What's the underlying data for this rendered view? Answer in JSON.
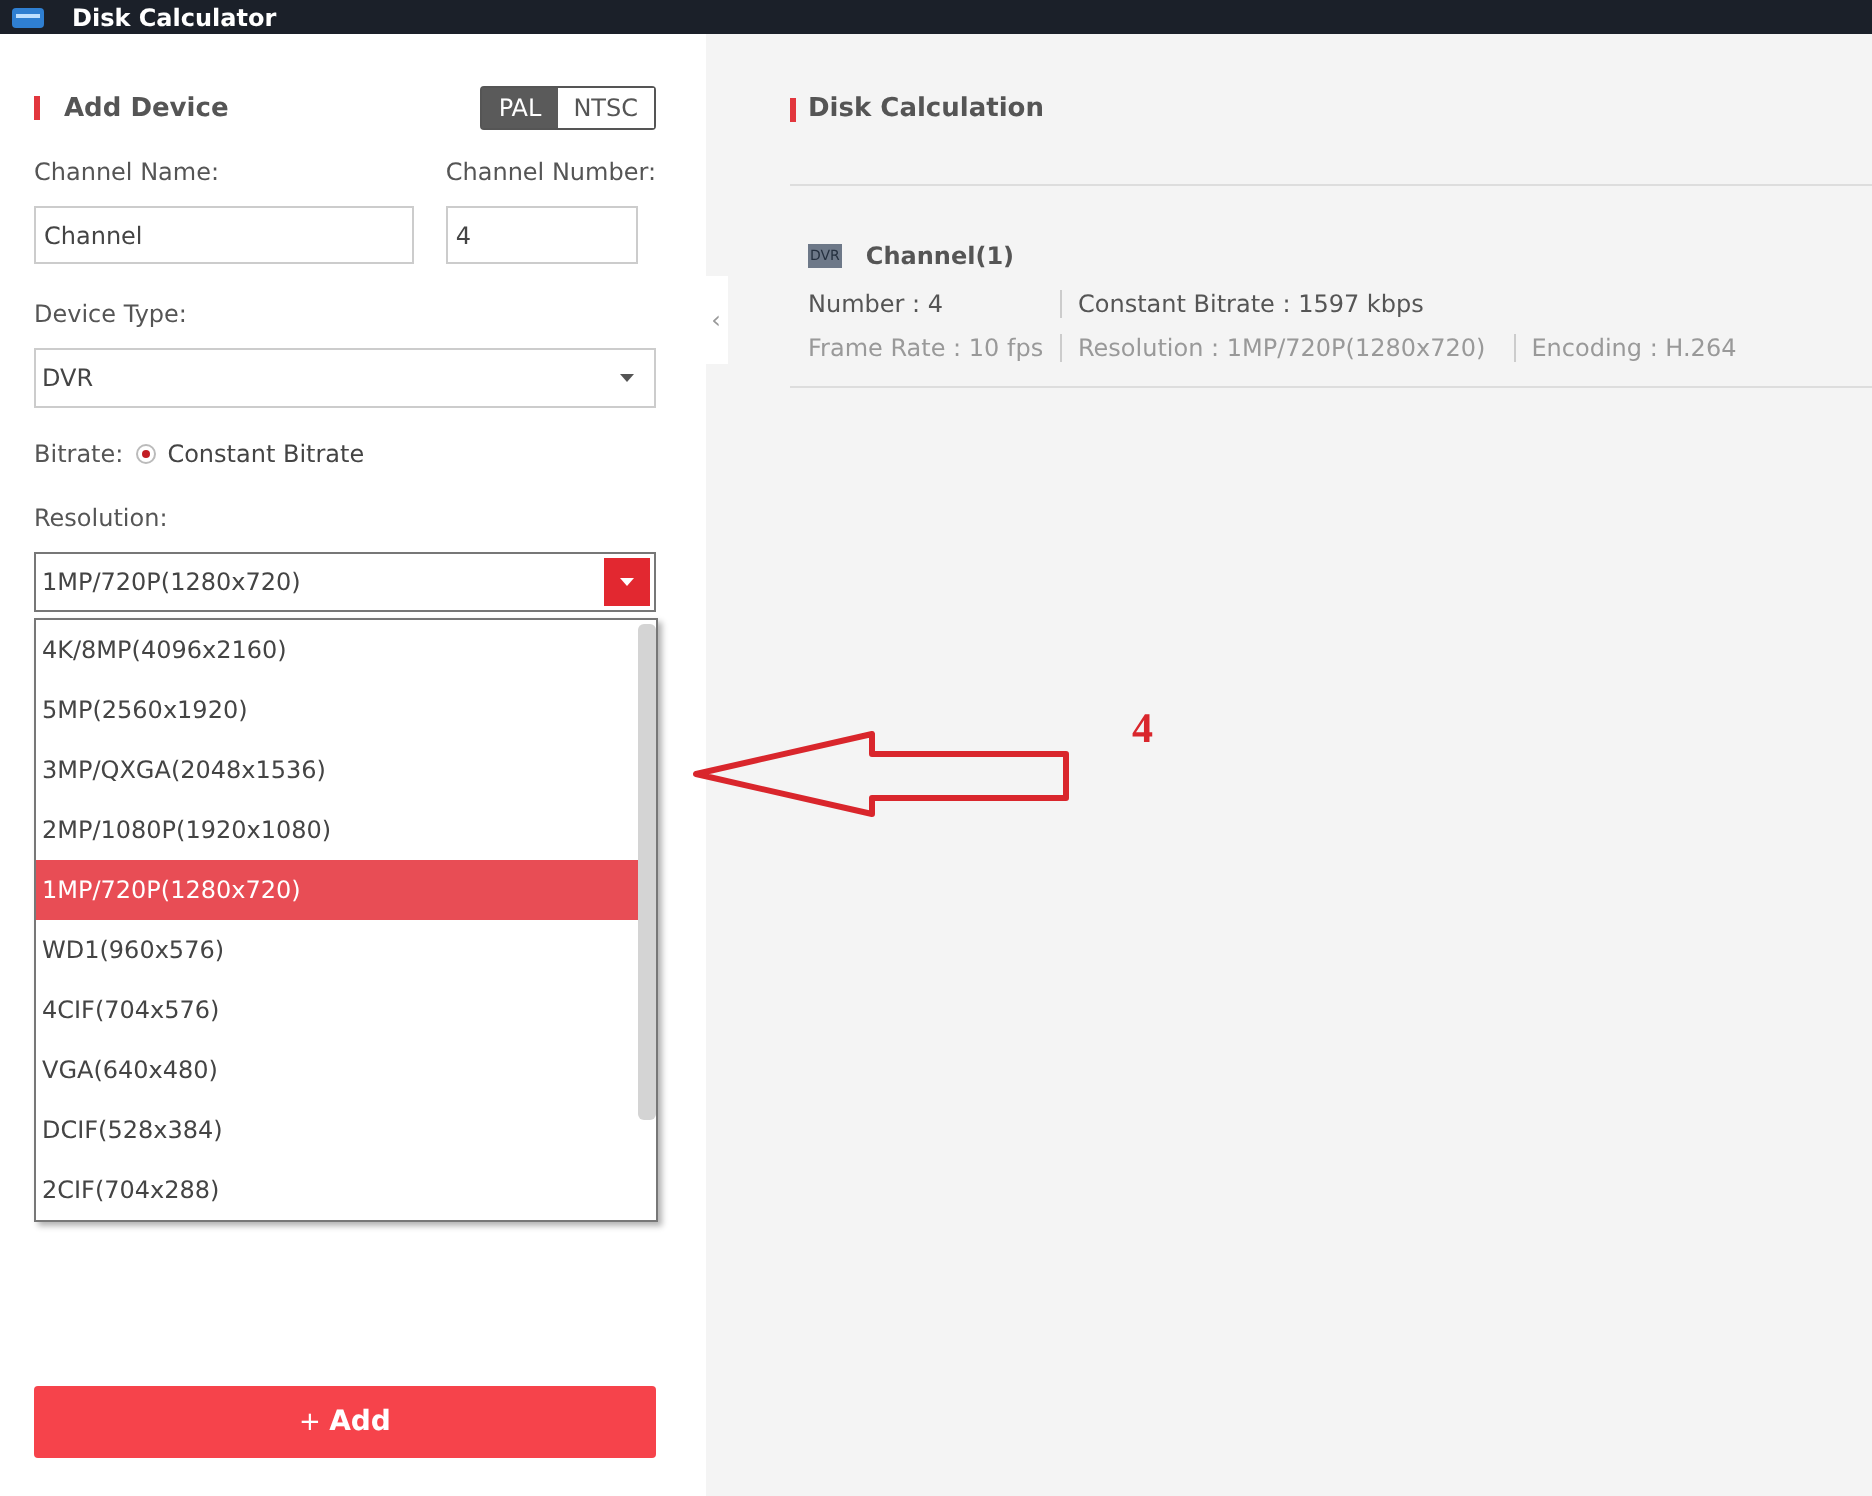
{
  "window": {
    "title": "Disk Calculator"
  },
  "add_device": {
    "title": "Add Device",
    "standards": [
      {
        "label": "PAL",
        "selected": true
      },
      {
        "label": "NTSC",
        "selected": false
      }
    ],
    "channel_name": {
      "label": "Channel Name:",
      "value": "Channel"
    },
    "channel_number": {
      "label": "Channel Number:",
      "value": "4"
    },
    "device_type": {
      "label": "Device Type:",
      "value": "DVR"
    },
    "bitrate": {
      "label": "Bitrate:",
      "option": "Constant Bitrate",
      "selected": true
    },
    "resolution": {
      "label": "Resolution:",
      "value": "1MP/720P(1280x720)",
      "expanded": true,
      "options": [
        {
          "label": "4K/8MP(4096x2160)",
          "selected": false
        },
        {
          "label": "5MP(2560x1920)",
          "selected": false
        },
        {
          "label": "3MP/QXGA(2048x1536)",
          "selected": false
        },
        {
          "label": "2MP/1080P(1920x1080)",
          "selected": false
        },
        {
          "label": "1MP/720P(1280x720)",
          "selected": true
        },
        {
          "label": "WD1(960x576)",
          "selected": false
        },
        {
          "label": "4CIF(704x576)",
          "selected": false
        },
        {
          "label": "VGA(640x480)",
          "selected": false
        },
        {
          "label": "DCIF(528x384)",
          "selected": false
        },
        {
          "label": "2CIF(704x288)",
          "selected": false
        }
      ]
    },
    "add_button": {
      "icon": "+",
      "label": "Add"
    }
  },
  "collapse_handle": "‹",
  "disk_calculation": {
    "title": "Disk Calculation",
    "channels": [
      {
        "type_badge": "DVR",
        "name": "Channel(1)",
        "number": "Number : 4",
        "bitrate": "Constant Bitrate : 1597 kbps",
        "frame_rate": "Frame Rate : 10 fps",
        "resolution": "Resolution : 1MP/720P(1280x720)",
        "encoding": "Encoding : H.264"
      }
    ]
  },
  "annotation": {
    "label": "4"
  }
}
